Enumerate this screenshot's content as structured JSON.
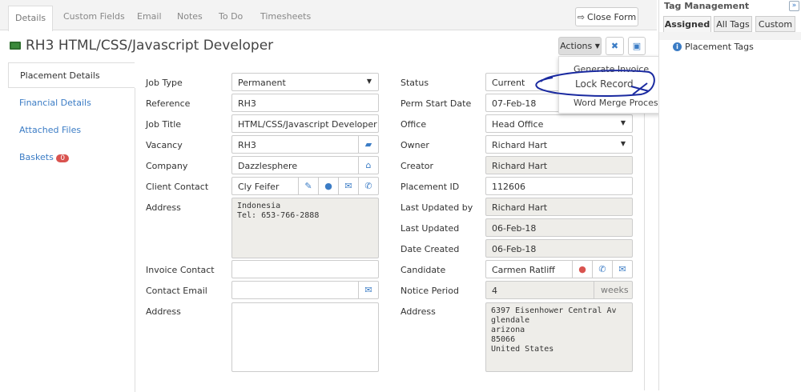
{
  "tabs": [
    "Details",
    "Custom Fields",
    "Email",
    "Notes",
    "To Do",
    "Timesheets"
  ],
  "close_form": "Close Form",
  "title": "RH3 HTML/CSS/Javascript Developer",
  "actions": {
    "label": "Actions",
    "menu": [
      "Generate Invoice",
      "Lock Record",
      "Word Merge Processor"
    ]
  },
  "nav": {
    "items": [
      "Placement Details",
      "Financial Details",
      "Attached Files",
      "Baskets"
    ],
    "baskets_count": "0"
  },
  "left": {
    "job_type": {
      "label": "Job Type",
      "value": "Permanent"
    },
    "reference": {
      "label": "Reference",
      "value": "RH3"
    },
    "job_title": {
      "label": "Job Title",
      "value": "HTML/CSS/Javascript Developer"
    },
    "vacancy": {
      "label": "Vacancy",
      "value": "RH3"
    },
    "company": {
      "label": "Company",
      "value": "Dazzlesphere"
    },
    "client_contact": {
      "label": "Client Contact",
      "value": "Cly Feifer"
    },
    "address": {
      "label": "Address",
      "value": "Indonesia\nTel: 653-766-2888"
    },
    "invoice_contact": {
      "label": "Invoice Contact",
      "value": ""
    },
    "contact_email": {
      "label": "Contact Email",
      "value": ""
    },
    "address2": {
      "label": "Address",
      "value": ""
    }
  },
  "right": {
    "status": {
      "label": "Status",
      "value": "Current"
    },
    "perm_start": {
      "label": "Perm Start Date",
      "value": "07-Feb-18"
    },
    "office": {
      "label": "Office",
      "value": "Head Office"
    },
    "owner": {
      "label": "Owner",
      "value": "Richard Hart"
    },
    "creator": {
      "label": "Creator",
      "value": "Richard Hart"
    },
    "placement_id": {
      "label": "Placement ID",
      "value": "112606"
    },
    "last_updated_by": {
      "label": "Last Updated by",
      "value": "Richard Hart"
    },
    "last_updated": {
      "label": "Last Updated",
      "value": "06-Feb-18"
    },
    "date_created": {
      "label": "Date Created",
      "value": "06-Feb-18"
    },
    "candidate": {
      "label": "Candidate",
      "value": "Carmen Ratliff"
    },
    "notice_period": {
      "label": "Notice Period",
      "value": "4",
      "unit": "weeks"
    },
    "address": {
      "label": "Address",
      "value": "6397 Eisenhower Central Av\nglendale\narizona\n85066\nUnited States"
    }
  },
  "tag_panel": {
    "title": "Tag Management",
    "tabs": [
      "Assigned",
      "All Tags",
      "Custom"
    ],
    "section": "Placement Tags"
  },
  "colors": {
    "link": "#3b7cc5",
    "badge": "#d9534f",
    "annotation": "#1a2aa0"
  }
}
